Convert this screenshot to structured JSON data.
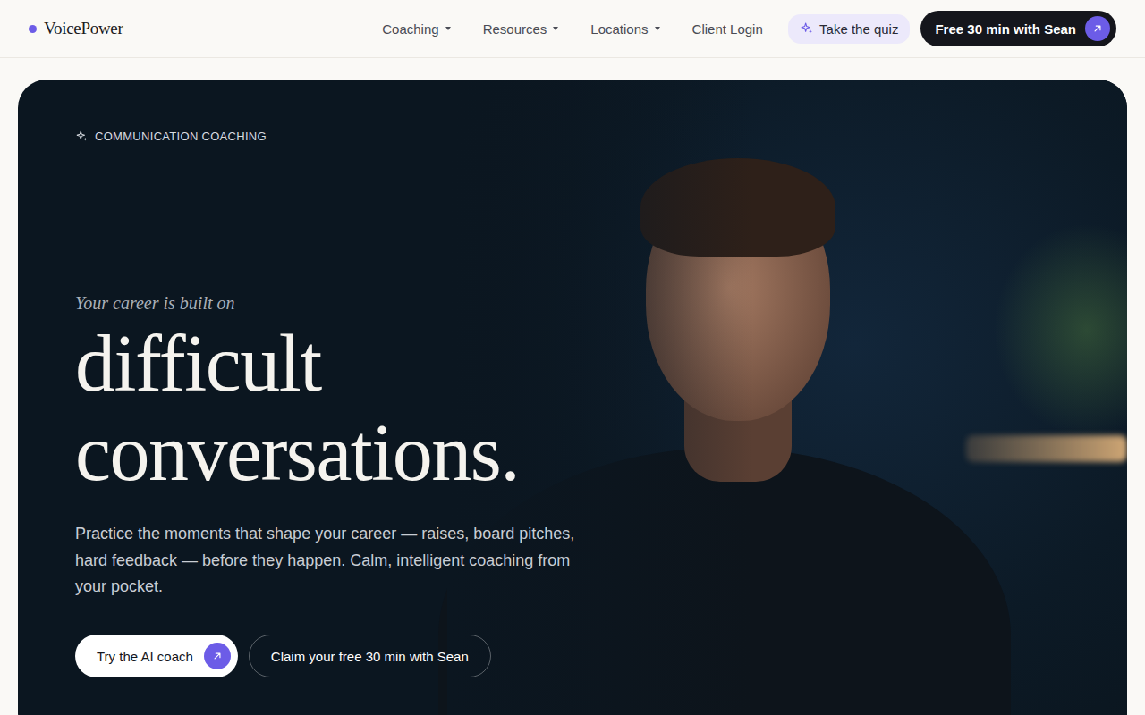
{
  "brand": {
    "name": "VoicePower"
  },
  "nav": [
    {
      "label": "Coaching",
      "has_menu": true
    },
    {
      "label": "Resources",
      "has_menu": true
    },
    {
      "label": "Locations",
      "has_menu": true
    },
    {
      "label": "Client Login",
      "has_menu": false
    }
  ],
  "header_actions": {
    "quiz": "Take the quiz",
    "cta": "Free 30 min with Sean"
  },
  "hero": {
    "eyebrow": "COMMUNICATION COACHING",
    "intro": "Your career is built on",
    "headline": [
      "difficult",
      "conversations."
    ],
    "body": "Practice the moments that shape your career — raises, board pitches, hard feedback — before they happen. Calm, intelligent coaching from your pocket.",
    "buttons": [
      {
        "label": "Try the AI coach",
        "kind": "primary"
      },
      {
        "label": "Claim your free 30 min with Sean",
        "kind": "secondary"
      }
    ]
  }
}
